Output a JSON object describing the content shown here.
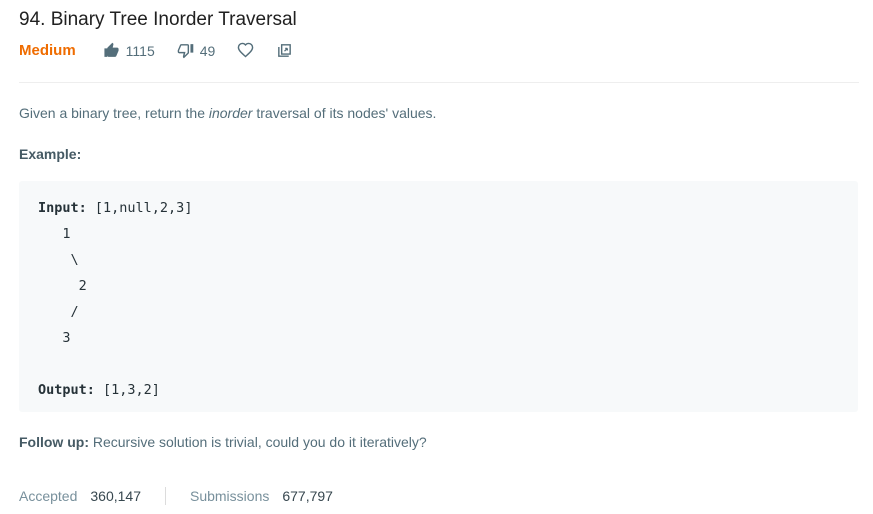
{
  "problem": {
    "title": "94. Binary Tree Inorder Traversal",
    "difficulty": "Medium",
    "likes": "1115",
    "dislikes": "49"
  },
  "description": {
    "before": "Given a binary tree, return the ",
    "emphasis": "inorder",
    "after": " traversal of its nodes' values."
  },
  "example": {
    "label": "Example:",
    "input_label": "Input:",
    "input_value": " [1,null,2,3]",
    "tree_lines": [
      "   1",
      "    \\",
      "     2",
      "    /",
      "   3"
    ],
    "output_label": "Output:",
    "output_value": " [1,3,2]"
  },
  "followup": {
    "label": "Follow up:",
    "text": " Recursive solution is trivial, could you do it iteratively?"
  },
  "stats": {
    "accepted_label": "Accepted",
    "accepted_value": "360,147",
    "submissions_label": "Submissions",
    "submissions_value": "677,797"
  },
  "colors": {
    "difficulty_medium": "#ef6c00",
    "code_background": "#f7f9fa",
    "text_muted": "#546e7a"
  },
  "icons": [
    "thumbs-up-icon",
    "thumbs-down-icon",
    "heart-icon",
    "share-icon"
  ]
}
